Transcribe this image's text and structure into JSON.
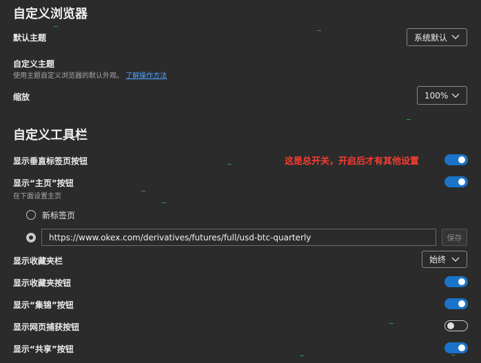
{
  "appearance": {
    "title": "自定义浏览器",
    "default_theme_label": "默认主题",
    "default_theme_value": "系统默认",
    "custom_theme_label": "自定义主题",
    "custom_theme_desc": "使用主题自定义浏览器的默认外观。",
    "custom_theme_link": "了解操作方法",
    "zoom_label": "缩放",
    "zoom_value": "100%"
  },
  "toolbar": {
    "title": "自定义工具栏",
    "vertical_tabs_label": "显示垂直标签页按钮",
    "annotation": "这是总开关，开启后才有其他设置",
    "home_label": "显示“主页”按钮",
    "home_desc": "在下面设置主页",
    "new_tab_option": "新标签页",
    "home_url": "https://www.okex.com/derivatives/futures/full/usd-btc-quarterly",
    "save_label": "保存",
    "favorites_bar_label": "显示收藏夹栏",
    "favorites_bar_value": "始终",
    "favorites_button_label": "显示收藏夹按钮",
    "collections_label": "显示“集锦”按钮",
    "web_capture_label": "显示网页捕获按钮",
    "share_label": "显示“共享”按钮"
  },
  "colors": {
    "accent": "#1a73c8",
    "annotation": "#ff3b2f",
    "background": "#2b2b2b"
  }
}
